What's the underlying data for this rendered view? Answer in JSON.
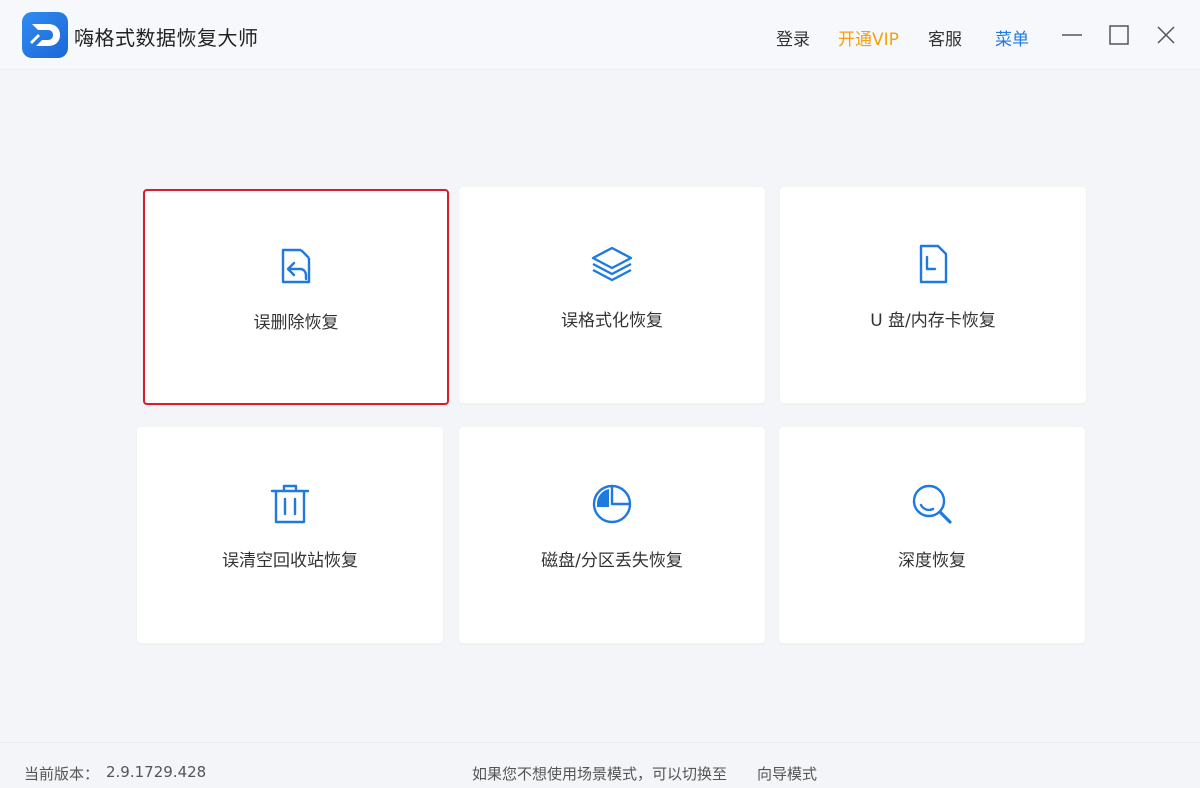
{
  "app": {
    "title": "嗨格式数据恢复大师"
  },
  "header": {
    "login": "登录",
    "vip": "开通VIP",
    "service": "客服",
    "menu": "菜单"
  },
  "window_controls": {
    "minimize_icon": "minimize-icon",
    "maximize_icon": "maximize-icon",
    "close_icon": "close-icon"
  },
  "colors": {
    "accent": "#1e7ae0",
    "vip": "#f5a10a",
    "selected_border": "#d91e2b"
  },
  "cards": [
    {
      "label": "误删除恢复",
      "icon": "file-restore-icon",
      "selected": true
    },
    {
      "label": "误格式化恢复",
      "icon": "layers-icon",
      "selected": false
    },
    {
      "label": "U 盘/内存卡恢复",
      "icon": "sd-card-icon",
      "selected": false
    },
    {
      "label": "误清空回收站恢复",
      "icon": "trash-icon",
      "selected": false
    },
    {
      "label": "磁盘/分区丢失恢复",
      "icon": "pie-chart-icon",
      "selected": false
    },
    {
      "label": "深度恢复",
      "icon": "search-icon",
      "selected": false
    }
  ],
  "status": {
    "version_label": "当前版本：",
    "version_value": "2.9.1729.428",
    "hint": "如果您不想使用场景模式，可以切换至",
    "guide_link": "向导模式"
  }
}
